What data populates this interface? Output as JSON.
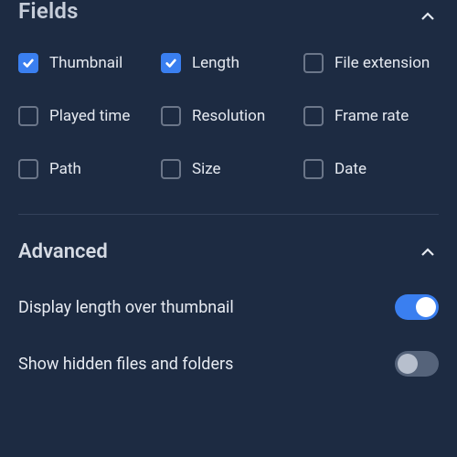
{
  "sections": {
    "fields": {
      "title": "Fields",
      "expanded": true,
      "items": [
        {
          "label": "Thumbnail",
          "checked": true
        },
        {
          "label": "Length",
          "checked": true
        },
        {
          "label": "File extension",
          "checked": false
        },
        {
          "label": "Played time",
          "checked": false
        },
        {
          "label": "Resolution",
          "checked": false
        },
        {
          "label": "Frame rate",
          "checked": false
        },
        {
          "label": "Path",
          "checked": false
        },
        {
          "label": "Size",
          "checked": false
        },
        {
          "label": "Date",
          "checked": false
        }
      ]
    },
    "advanced": {
      "title": "Advanced",
      "expanded": true,
      "settings": [
        {
          "label": "Display length over thumbnail",
          "value": true
        },
        {
          "label": "Show hidden files and folders",
          "value": false
        }
      ]
    }
  },
  "colors": {
    "background": "#1d2b42",
    "accent": "#3a7ff0",
    "text": "#e5e9f0",
    "muted": "#6b7689"
  }
}
